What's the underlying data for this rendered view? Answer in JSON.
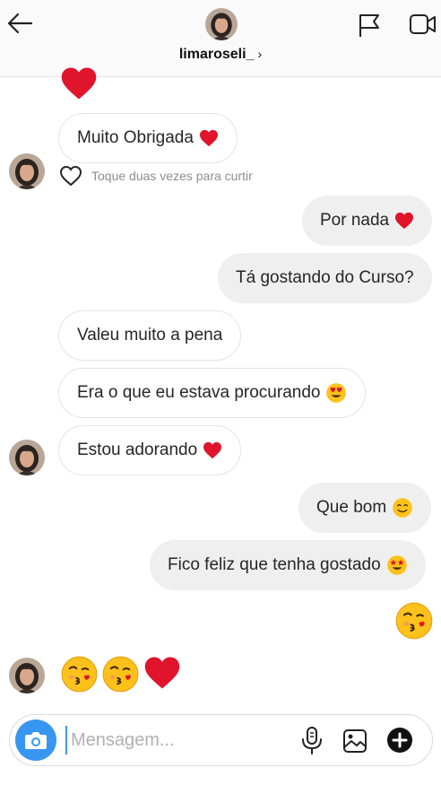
{
  "header": {
    "username": "limaroseli_",
    "chevron": "›",
    "icons": [
      "back-arrow-icon",
      "flag-icon",
      "video-camera-icon"
    ]
  },
  "messages": [
    {
      "side": "in",
      "text": "Muito Obrigada",
      "emoji": "heart"
    },
    {
      "side": "out",
      "text": "Por nada",
      "emoji": "heart"
    },
    {
      "side": "out",
      "text": "Tá gostando do Curso?"
    },
    {
      "side": "in",
      "text": "Valeu muito a pena"
    },
    {
      "side": "in",
      "text": "Era o que eu estava procurando",
      "emoji": "heart-eyes"
    },
    {
      "side": "in",
      "text": "Estou adorando",
      "emoji": "heart"
    },
    {
      "side": "out",
      "text": "Que bom",
      "emoji": "smiling-face"
    },
    {
      "side": "out",
      "text": "Fico feliz que tenha gostado",
      "emoji": "star-struck"
    }
  ],
  "like_hint": "Toque duas vezes para curtir",
  "emoji_messages": {
    "out": [
      "kissing-face"
    ],
    "in": [
      "kissing-face",
      "kissing-face",
      "heart"
    ]
  },
  "composer": {
    "placeholder": "Mensagem...",
    "icons": [
      "camera-icon",
      "microphone-icon",
      "gallery-icon",
      "plus-icon"
    ]
  },
  "colors": {
    "accent": "#3797f0",
    "heart": "#e0152b",
    "outgoing_bubble": "#efefef",
    "incoming_border": "#e4e4e4"
  }
}
